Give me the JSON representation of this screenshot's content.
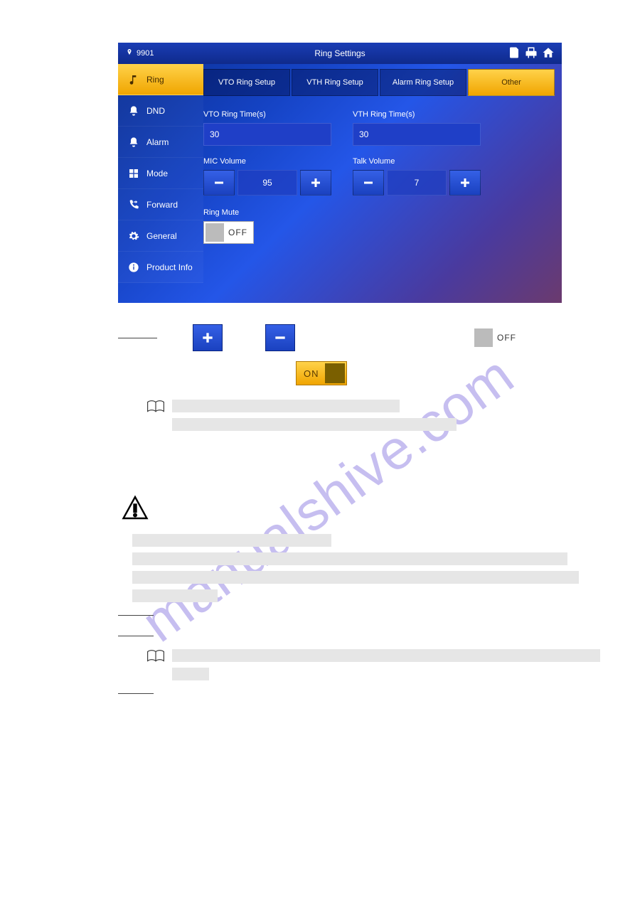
{
  "topbar": {
    "device_id": "9901",
    "title": "Ring Settings"
  },
  "sidebar": {
    "items": [
      {
        "label": "Ring",
        "icon": "note"
      },
      {
        "label": "DND",
        "icon": "bell"
      },
      {
        "label": "Alarm",
        "icon": "bell-ring"
      },
      {
        "label": "Mode",
        "icon": "grid"
      },
      {
        "label": "Forward",
        "icon": "phone-forward"
      },
      {
        "label": "General",
        "icon": "gear"
      },
      {
        "label": "Product Info",
        "icon": "info"
      }
    ]
  },
  "tabs": {
    "items": [
      "VTO Ring Setup",
      "VTH Ring Setup",
      "Alarm Ring Setup",
      "Other"
    ],
    "active_index": 3
  },
  "settings": {
    "vto_ring_time": {
      "label": "VTO Ring Time(s)",
      "value": "30"
    },
    "vth_ring_time": {
      "label": "VTH Ring Time(s)",
      "value": "30"
    },
    "mic_volume": {
      "label": "MIC Volume",
      "value": "95"
    },
    "talk_volume": {
      "label": "Talk Volume",
      "value": "7"
    },
    "ring_mute": {
      "label": "Ring Mute",
      "state": "OFF"
    }
  },
  "below": {
    "off_label": "OFF",
    "on_label": "ON",
    "watermark": "manualshive.com"
  }
}
